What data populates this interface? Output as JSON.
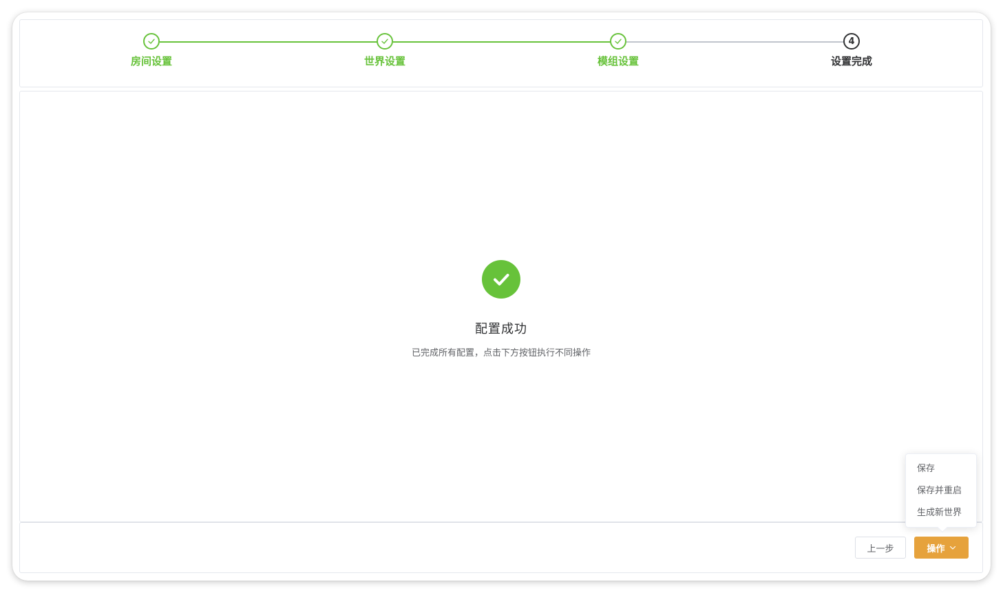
{
  "steps": [
    {
      "label": "房间设置",
      "status": "finished"
    },
    {
      "label": "世界设置",
      "status": "finished"
    },
    {
      "label": "模组设置",
      "status": "finished"
    },
    {
      "label": "设置完成",
      "status": "current",
      "number": "4"
    }
  ],
  "result": {
    "title": "配置成功",
    "subtitle": "已完成所有配置，点击下方按钮执行不同操作",
    "icon": "check-circle-icon"
  },
  "footer": {
    "prev_label": "上一步",
    "ops_label": "操作"
  },
  "dropdown": {
    "items": [
      "保存",
      "保存并重启",
      "生成新世界"
    ]
  },
  "colors": {
    "success": "#67c23a",
    "warning": "#e6a23c",
    "text": "#303133",
    "pending_line": "#c0c4cc"
  }
}
